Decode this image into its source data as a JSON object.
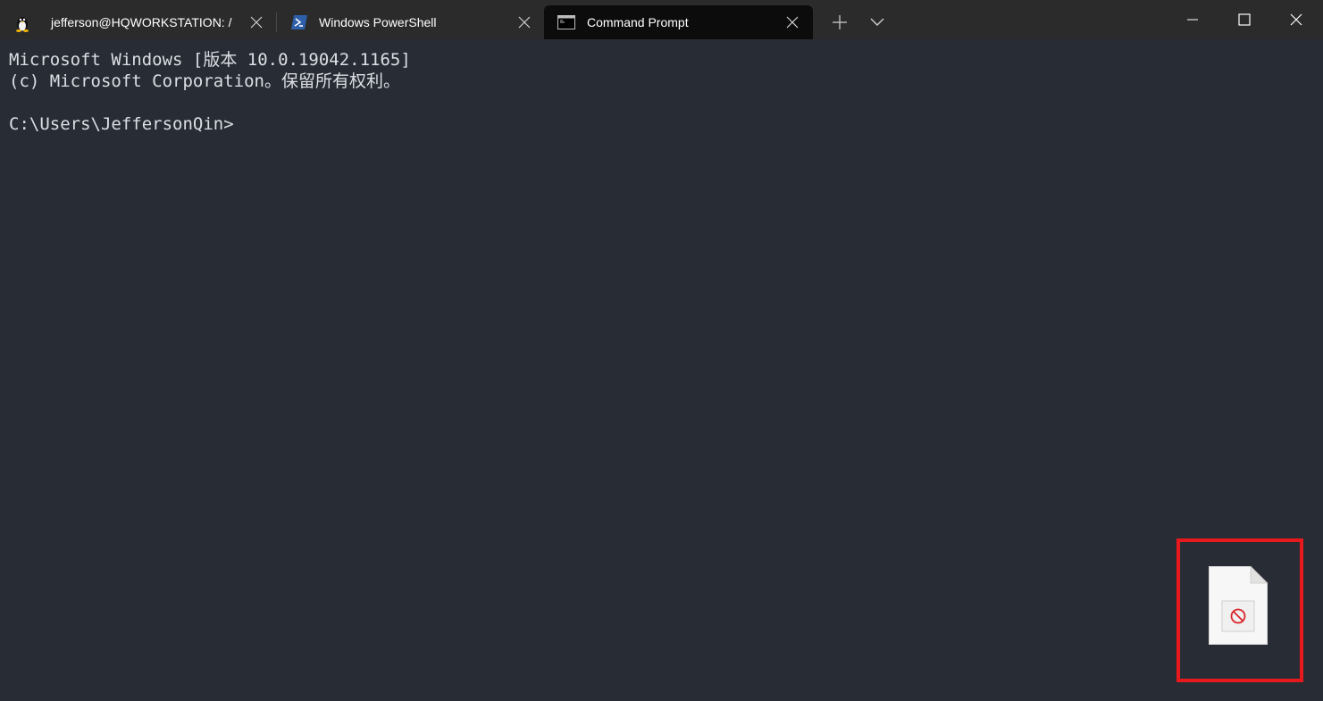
{
  "tabs": [
    {
      "label": "jefferson@HQWORKSTATION: /",
      "icon": "linux-penguin-icon",
      "active": false
    },
    {
      "label": "Windows PowerShell",
      "icon": "powershell-icon",
      "active": false
    },
    {
      "label": "Command Prompt",
      "icon": "cmd-icon",
      "active": true
    }
  ],
  "titlebar": {
    "new_tab_icon": "plus-icon",
    "dropdown_icon": "chevron-down-icon",
    "window_controls": [
      "minimize-icon",
      "maximize-icon",
      "close-icon"
    ]
  },
  "terminal": {
    "lines": [
      "Microsoft Windows [版本 10.0.19042.1165]",
      "(c) Microsoft Corporation。保留所有权利。",
      "",
      "C:\\Users\\JeffersonQin>"
    ]
  },
  "drop_target": {
    "icon": "blocked-file-icon",
    "highlight_color": "#e8191c"
  },
  "colors": {
    "titlebar_bg": "#2b2b2b",
    "active_tab_bg": "#0c0c0c",
    "terminal_bg": "#282c34",
    "terminal_fg": "#dcdfe4",
    "powershell_blue": "#2d5fa8"
  }
}
